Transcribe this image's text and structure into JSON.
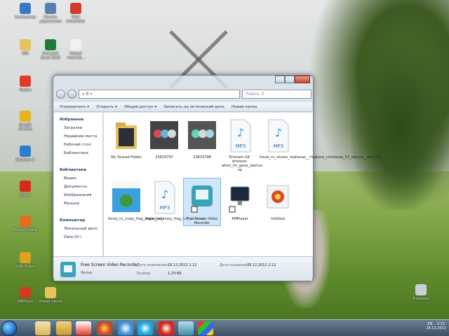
{
  "desktop": {
    "icons": [
      {
        "label": "Компьютер",
        "color": "#3a78c2"
      },
      {
        "label": "Панель управления",
        "color": "#5580b0"
      },
      {
        "label": "IObit Uninstaller",
        "color": "#d33b2c"
      },
      {
        "label": "000",
        "color": "#e8c25a"
      },
      {
        "label": "Microsoft Excel 2010",
        "color": "#1f7a3a"
      },
      {
        "label": "Новый текстов...",
        "color": "#f1f1f1"
      },
      {
        "label": "Yandex",
        "color": "#e23a2a"
      },
      {
        "label": "Google Chrome",
        "color": "#e8b31c"
      },
      {
        "label": "Maxthon 3",
        "color": "#2c7bd1"
      },
      {
        "label": "Opera",
        "color": "#d8281d"
      },
      {
        "label": "Mozilla Firefox",
        "color": "#e66b1a"
      },
      {
        "label": "GOM Player",
        "color": "#e0a11c"
      },
      {
        "label": "SMPlayer",
        "color": "#d23a20"
      },
      {
        "label": "Новая папка",
        "color": "#e8c25a"
      },
      {
        "label": "Корзина",
        "color": "#c9d1d8"
      }
    ]
  },
  "window": {
    "address": "« 0 »",
    "search_placeholder": "Поиск: 0",
    "toolbar": [
      "Упорядочить ▾",
      "Открыть ▾",
      "Общий доступ ▾",
      "Записать на оптический диск",
      "Новая папка"
    ],
    "sidebar": [
      {
        "label": "Избранное",
        "kind": "group"
      },
      {
        "label": "Загрузки",
        "kind": "sub"
      },
      {
        "label": "Недавние места",
        "kind": "sub"
      },
      {
        "label": "Рабочий стол",
        "kind": "sub"
      },
      {
        "label": "Библиотеки",
        "kind": "sub"
      },
      {
        "label": "",
        "kind": "gap"
      },
      {
        "label": "Библиотеки",
        "kind": "group"
      },
      {
        "label": "Видео",
        "kind": "sub"
      },
      {
        "label": "Документы",
        "kind": "sub"
      },
      {
        "label": "Изображения",
        "kind": "sub"
      },
      {
        "label": "Музыка",
        "kind": "sub"
      },
      {
        "label": "",
        "kind": "gap"
      },
      {
        "label": "Компьютер",
        "kind": "group"
      },
      {
        "label": "Локальный диск",
        "kind": "sub"
      },
      {
        "label": "Data (D:)",
        "kind": "sub"
      }
    ],
    "items": [
      {
        "label": "My Shared Folder",
        "kind": "folder"
      },
      {
        "label": "23633797",
        "kind": "image"
      },
      {
        "label": "23633798",
        "kind": "image2"
      },
      {
        "label": "Eminem-18-eminem-when_im_gone_(exclus-sp",
        "kind": "mp3"
      },
      {
        "label": "fonzo_ru_vkcom_realtones__ringtone_christmas_57_rezone__last_chri...",
        "kind": "mp3"
      },
      {
        "label": "fonzo_ru_crazy_frog_jingle_bells",
        "kind": "crazy"
      },
      {
        "label": "fonzo_ru_crazy_frog_last_cristmas",
        "kind": "mp3"
      },
      {
        "label": "Free Screen Video Recorder",
        "kind": "app",
        "selected": true
      },
      {
        "label": "KMPlayer",
        "kind": "monitor"
      },
      {
        "label": "Untitled",
        "kind": "film"
      }
    ],
    "status": {
      "name": "Free Screen Video Recorder",
      "type": "Ярлык",
      "modified_label": "Дата изменения:",
      "modified": "28.12.2012 2:12",
      "created_label": "Дата создания:",
      "created": "28.12.2012 2:12",
      "size_label": "Размер:",
      "size": "1,29 КБ"
    }
  },
  "taskbar": {
    "lang": "EN",
    "time": "2:12",
    "date": "28.12.2012"
  }
}
